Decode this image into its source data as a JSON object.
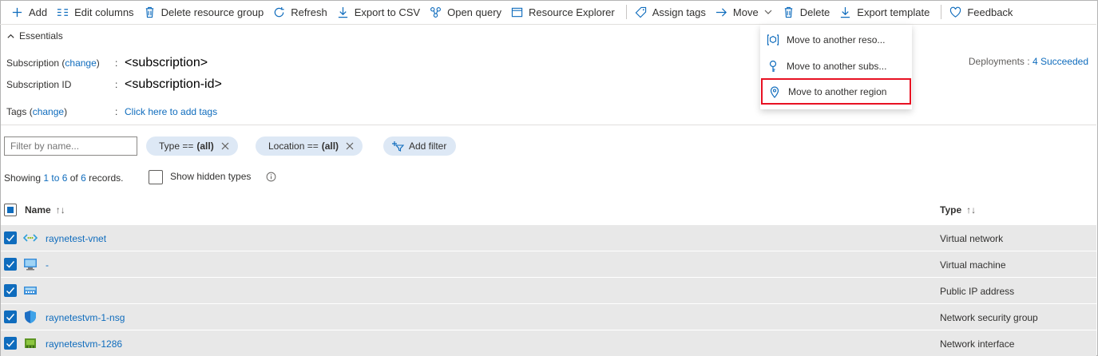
{
  "toolbar": {
    "add": "Add",
    "edit_columns": "Edit columns",
    "delete_group": "Delete resource group",
    "refresh": "Refresh",
    "export_csv": "Export to CSV",
    "open_query": "Open query",
    "resource_explorer": "Resource Explorer",
    "assign_tags": "Assign tags",
    "move": "Move",
    "delete": "Delete",
    "export_template": "Export template",
    "feedback": "Feedback"
  },
  "move_menu": {
    "items": [
      {
        "label": "Move to another reso..."
      },
      {
        "label": "Move to another subs..."
      },
      {
        "label": "Move to another region"
      }
    ]
  },
  "essentials": {
    "title": "Essentials",
    "subscription_label": "Subscription",
    "change": "change",
    "subscription_value": "<subscription>",
    "subscription_id_label": "Subscription ID",
    "subscription_id_value": "<subscription-id>",
    "tags_label": "Tags",
    "tags_value": "Click here to add tags",
    "deployments_label": "Deployments",
    "deployments_value": "4 Succeeded"
  },
  "filters": {
    "name_placeholder": "Filter by name...",
    "type_label": "Type == ",
    "type_value": "(all)",
    "location_label": "Location == ",
    "location_value": "(all)",
    "add_filter": "Add filter"
  },
  "records": {
    "showing_prefix": "Showing ",
    "range": "1 to 6",
    "of": " of ",
    "total": "6",
    "suffix": " records.",
    "show_hidden": "Show hidden types"
  },
  "table": {
    "col_name": "Name",
    "col_type": "Type",
    "sort_both": "↑↓",
    "rows": [
      {
        "name": "raynetest-vnet",
        "type": "Virtual network",
        "icon": "vnet-icon"
      },
      {
        "name": "-",
        "type": "Virtual machine",
        "icon": "vm-icon"
      },
      {
        "name": "",
        "type": "Public IP address",
        "icon": "public-ip-icon"
      },
      {
        "name": "raynetestvm-1-nsg",
        "type": "Network security group",
        "icon": "nsg-icon"
      },
      {
        "name": "raynetestvm-1286",
        "type": "Network interface",
        "icon": "nic-icon"
      }
    ]
  }
}
